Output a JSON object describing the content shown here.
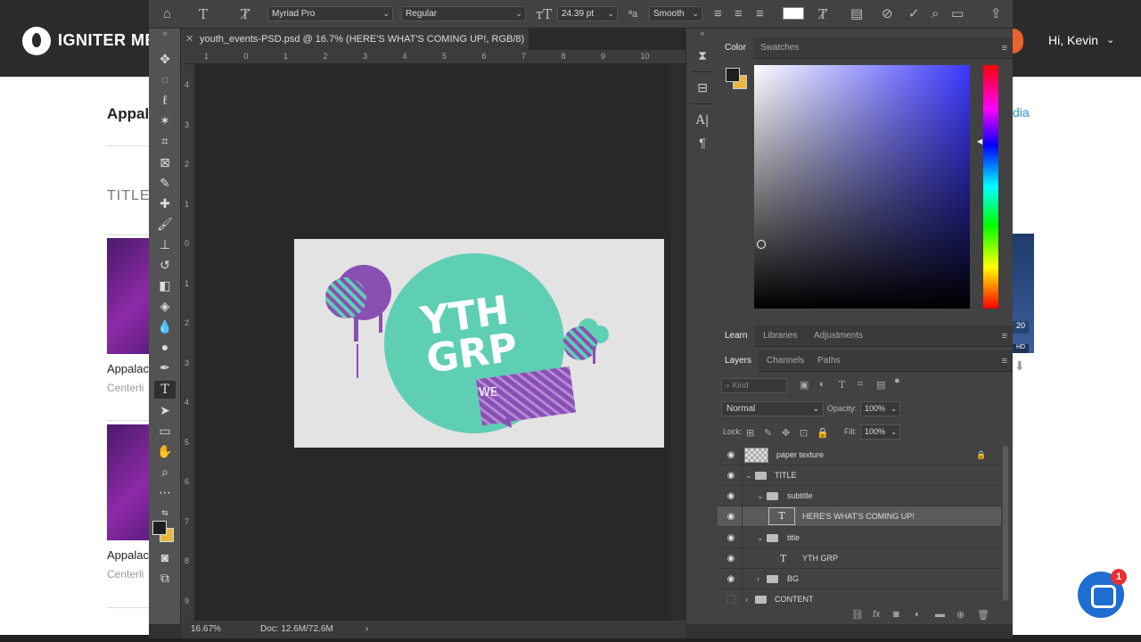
{
  "website": {
    "brand": "IGNITER ME",
    "greeting": "Hi, Kevin",
    "page_heading": "Appala",
    "section_label": "TITLE",
    "items": [
      {
        "title": "Appalac",
        "subtitle": "Centerli"
      },
      {
        "title": "Appalac",
        "subtitle": "Centerli"
      }
    ],
    "right_link": "dia",
    "right_badge": "20",
    "right_badge2": "HD",
    "chat_badge": "1"
  },
  "photoshop": {
    "options_bar": {
      "font_family": "Myriad Pro",
      "font_style": "Regular",
      "font_size": "24.39 pt",
      "antialias_label": "ªa",
      "antialias": "Smooth"
    },
    "document_tab": {
      "title": "youth_events-PSD.psd @ 16.7% (HERE'S WHAT'S COMING UP!, RGB/8) *"
    },
    "ruler_h_labels": [
      "1",
      "0",
      "1",
      "2",
      "3",
      "4",
      "5",
      "6",
      "7",
      "8",
      "9",
      "10"
    ],
    "ruler_v_labels": [
      "4",
      "3",
      "2",
      "1",
      "0",
      "1",
      "2",
      "3",
      "4",
      "5",
      "6",
      "7",
      "8",
      "9"
    ],
    "status": {
      "zoom": "16.67%",
      "doc_size": "Doc: 12.6M/72.6M",
      "arrow": "›"
    },
    "artboard": {
      "title_line1": "YTH",
      "title_line2": "GRP",
      "speech_text": "WE",
      "colors": {
        "teal": "#5fcfb4",
        "purple": "#8a4fb3",
        "paper": "#e3e3e3"
      }
    },
    "color_panel": {
      "tabs": [
        "Color",
        "Swatches"
      ],
      "foreground": "#1e1e1e",
      "background": "#e9b840",
      "hue_color": "#3b38ff"
    },
    "learn_panel": {
      "tabs": [
        "Learn",
        "Libraries",
        "Adjustments"
      ]
    },
    "layers_panel": {
      "tabs": [
        "Layers",
        "Channels",
        "Paths"
      ],
      "filter_kind": "Kind",
      "blend_mode": "Normal",
      "opacity_label": "Opacity:",
      "opacity": "100%",
      "lock_label": "Lock:",
      "fill_label": "Fill:",
      "fill": "100%",
      "layers": [
        {
          "name": "paper texture",
          "type": "image",
          "indent": 0,
          "locked": true,
          "visible": true
        },
        {
          "name": "TITLE",
          "type": "group",
          "indent": 0,
          "expanded": true,
          "visible": true
        },
        {
          "name": "subtitle",
          "type": "group",
          "indent": 1,
          "expanded": true,
          "visible": true
        },
        {
          "name": "HERE'S WHAT'S COMING UP!",
          "type": "text",
          "indent": 2,
          "selected": true,
          "visible": true
        },
        {
          "name": "title",
          "type": "group",
          "indent": 1,
          "expanded": true,
          "visible": true
        },
        {
          "name": "YTH GRP",
          "type": "text",
          "indent": 2,
          "visible": true
        },
        {
          "name": "BG",
          "type": "group",
          "indent": 1,
          "expanded": false,
          "visible": true
        },
        {
          "name": "CONTENT",
          "type": "group",
          "indent": 0,
          "expanded": false,
          "visible": false
        }
      ]
    }
  }
}
